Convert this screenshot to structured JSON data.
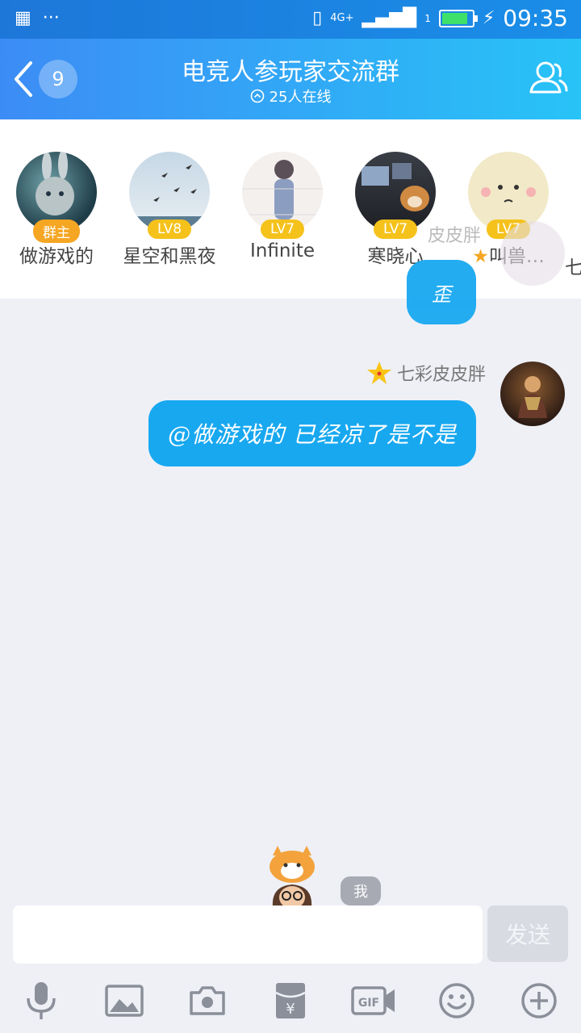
{
  "statusbar": {
    "time": "09:35",
    "network": "4G+",
    "sim": "1"
  },
  "header": {
    "unread_count": "9",
    "title": "电竞人参玩家交流群",
    "online": "25人在线"
  },
  "members": [
    {
      "name": "做游戏的",
      "badge": "群主"
    },
    {
      "name": "星空和黑夜",
      "badge": "LV8"
    },
    {
      "name": "Infinite",
      "badge": "LV7"
    },
    {
      "name": "寒晓心",
      "badge": "LV7"
    },
    {
      "name": "叫兽…",
      "badge": "LV7"
    },
    {
      "name": "七"
    }
  ],
  "chat": {
    "ghost_sender": "皮皮胖",
    "partial_bubble_text": "歪",
    "sender_name": "七彩皮皮胖",
    "message": "@做游戏的 已经凉了是不是"
  },
  "me_tag": "我",
  "input": {
    "placeholder": "",
    "send_label": "发送"
  },
  "colors": {
    "accent": "#18a8f0",
    "header_start": "#3c8cf5",
    "header_end": "#28c3f7"
  }
}
